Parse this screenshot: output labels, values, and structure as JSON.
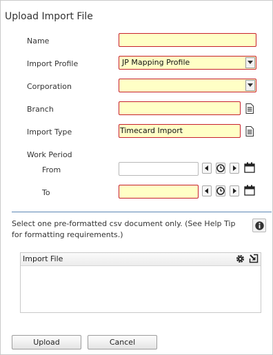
{
  "dialog": {
    "title": "Upload Import File"
  },
  "form": {
    "name": {
      "label": "Name",
      "value": ""
    },
    "import_profile": {
      "label": "Import Profile",
      "value": "JP Mapping Profile"
    },
    "corporation": {
      "label": "Corporation",
      "value": ""
    },
    "branch": {
      "label": "Branch",
      "value": ""
    },
    "import_type": {
      "label": "Import Type",
      "value": "Timecard Import"
    },
    "work_period": {
      "label": "Work Period",
      "from": {
        "label": "From",
        "value": ""
      },
      "to": {
        "label": "To",
        "value": ""
      }
    }
  },
  "help": {
    "text": "Select one pre-formatted csv document only. (See Help Tip for formatting requirements.)"
  },
  "import_panel": {
    "title": "Import File"
  },
  "buttons": {
    "upload": "Upload",
    "cancel": "Cancel"
  },
  "colors": {
    "required_border": "#c7202b",
    "required_fill": "#ffffc6",
    "divider": "#5a86b4"
  }
}
